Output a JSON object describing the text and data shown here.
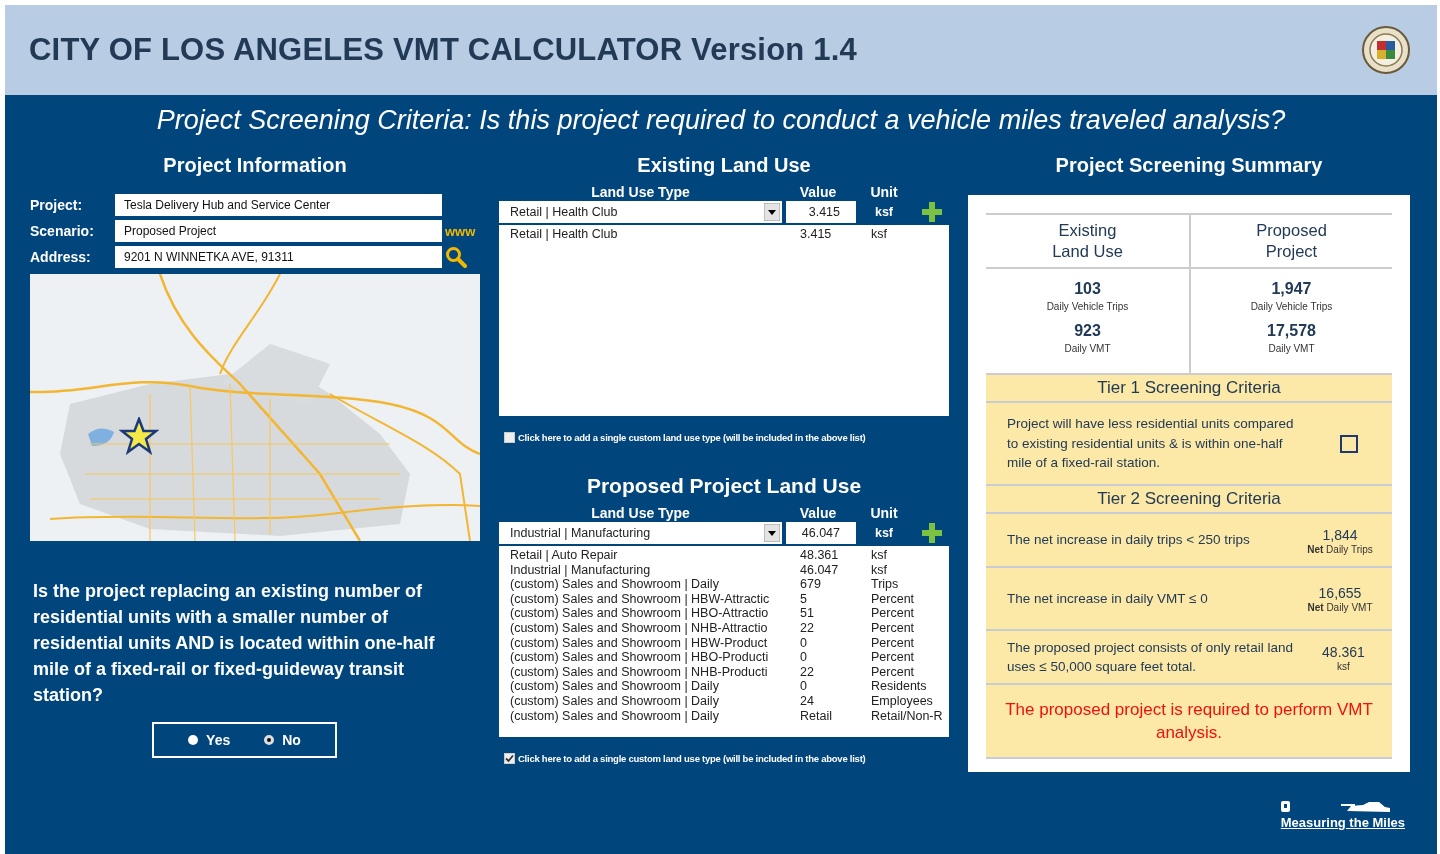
{
  "header": {
    "title": "CITY OF LOS ANGELES VMT CALCULATOR Version 1.4",
    "subtitle": "Project Screening Criteria: Is this project required to conduct a vehicle miles traveled analysis?"
  },
  "project_information": {
    "heading": "Project Information",
    "fields": [
      {
        "label": "Project:",
        "value": "Tesla Delivery Hub and Service Center"
      },
      {
        "label": "Scenario:",
        "value": "Proposed Project",
        "link": "www"
      },
      {
        "label": "Address:",
        "value": "9201 N WINNETKA AVE, 91311",
        "search_button": true
      }
    ],
    "question": "Is the project replacing an existing number of residential units with a smaller number of residential units AND is located within one-half mile of a fixed-rail or fixed-guideway transit station?",
    "options": [
      {
        "label": "Yes",
        "selected": false
      },
      {
        "label": "No",
        "selected": true
      }
    ]
  },
  "existing_land_use": {
    "heading": "Existing Land Use",
    "columns": [
      "Land Use Type",
      "Value",
      "Unit"
    ],
    "entry": {
      "type": "Retail | Health Club",
      "value": "3.415",
      "unit": "ksf"
    },
    "rows": [
      {
        "type": "Retail | Health Club",
        "value": "3.415",
        "unit": "ksf"
      }
    ],
    "custom_option": {
      "label": "Click here to add a single custom land use type (will be included in the above list)",
      "checked": false
    }
  },
  "proposed_land_use": {
    "heading": "Proposed Project Land Use",
    "columns": [
      "Land Use Type",
      "Value",
      "Unit"
    ],
    "entry": {
      "type": "Industrial | Manufacturing",
      "value": "46.047",
      "unit": "ksf"
    },
    "rows": [
      {
        "type": "Retail | Auto Repair",
        "value": "48.361",
        "unit": "ksf"
      },
      {
        "type": "Industrial | Manufacturing",
        "value": "46.047",
        "unit": "ksf"
      },
      {
        "type": "(custom) Sales and Showroom | Daily",
        "value": "679",
        "unit": "Trips"
      },
      {
        "type": "(custom) Sales and Showroom | HBW-Attractic",
        "value": "5",
        "unit": "Percent"
      },
      {
        "type": "(custom) Sales and Showroom | HBO-Attractio",
        "value": "51",
        "unit": "Percent"
      },
      {
        "type": "(custom) Sales and Showroom | NHB-Attractio",
        "value": "22",
        "unit": "Percent"
      },
      {
        "type": "(custom) Sales and Showroom | HBW-Product",
        "value": "0",
        "unit": "Percent"
      },
      {
        "type": "(custom) Sales and Showroom | HBO-Producti",
        "value": "0",
        "unit": "Percent"
      },
      {
        "type": "(custom) Sales and Showroom | NHB-Producti",
        "value": "22",
        "unit": "Percent"
      },
      {
        "type": "(custom) Sales and Showroom | Daily",
        "value": "0",
        "unit": "Residents"
      },
      {
        "type": "(custom) Sales and Showroom | Daily",
        "value": "24",
        "unit": "Employees"
      },
      {
        "type": "(custom) Sales and Showroom | Daily",
        "value": "Retail",
        "unit": "Retail/Non-R"
      }
    ],
    "custom_option": {
      "label": "Click here to add a single custom land use type (will be included in the above list)",
      "checked": true
    }
  },
  "summary": {
    "heading": "Project Screening Summary",
    "columns": [
      {
        "title": "Existing Land Use",
        "trips": "103",
        "trips_label": "Daily Vehicle Trips",
        "vmt": "923",
        "vmt_label": "Daily VMT"
      },
      {
        "title": "Proposed Project",
        "trips": "1,947",
        "trips_label": "Daily Vehicle Trips",
        "vmt": "17,578",
        "vmt_label": "Daily VMT"
      }
    ],
    "tier1": {
      "title": "Tier 1 Screening Criteria",
      "text": "Project will have less residential units compared to existing residential units & is within one-half mile of a fixed-rail station.",
      "checked": false
    },
    "tier2": {
      "title": "Tier 2 Screening Criteria",
      "criteria": [
        {
          "text": "The net increase in daily trips < 250 trips",
          "value": "1,844",
          "unit": "**Net** Daily Trips"
        },
        {
          "text": "The net increase in daily VMT ≤ 0",
          "value": "16,655",
          "unit": "**Net** Daily VMT"
        },
        {
          "text": "The proposed project consists of only retail land uses ≤ 50,000 square feet total.",
          "value": "48.361",
          "unit": "ksf"
        }
      ]
    },
    "result": "The proposed project is required to perform VMT analysis."
  },
  "footer": {
    "logo_text": "Measuring the Miles"
  }
}
